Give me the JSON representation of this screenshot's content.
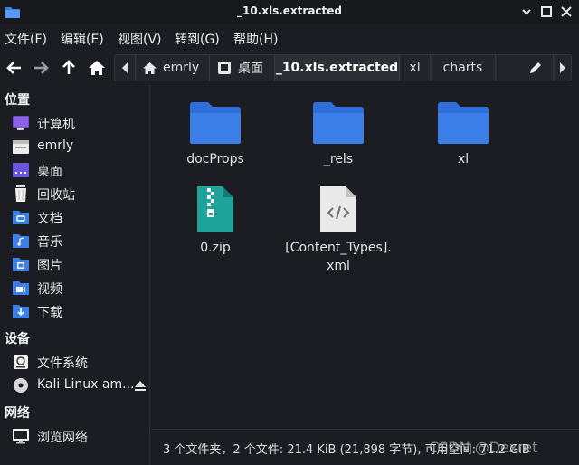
{
  "window": {
    "title": "_10.xls.extracted",
    "app_icon": "folder-icon",
    "controls": [
      "minimize-icon",
      "maximize-icon",
      "close-icon"
    ]
  },
  "menu": [
    "文件(F)",
    "编辑(E)",
    "视图(V)",
    "转到(G)",
    "帮助(H)"
  ],
  "toolbar": {
    "buttons": [
      "back-arrow-icon",
      "forward-arrow-icon",
      "up-arrow-icon",
      "home-icon"
    ],
    "path": [
      "emrly",
      "桌面",
      "_10.xls.extracted",
      "xl",
      "charts"
    ],
    "active_crumb": "_10.xls.extracted"
  },
  "sidebar": {
    "places_heading": "位置",
    "places": [
      {
        "label": "计算机",
        "icon": "computer-icon"
      },
      {
        "label": "emrly",
        "icon": "home-folder-icon"
      },
      {
        "label": "桌面",
        "icon": "desktop-icon"
      },
      {
        "label": "回收站",
        "icon": "trash-icon"
      },
      {
        "label": "文档",
        "icon": "documents-folder-icon"
      },
      {
        "label": "音乐",
        "icon": "music-folder-icon"
      },
      {
        "label": "图片",
        "icon": "pictures-folder-icon"
      },
      {
        "label": "视频",
        "icon": "videos-folder-icon"
      },
      {
        "label": "下载",
        "icon": "downloads-folder-icon"
      }
    ],
    "devices_heading": "设备",
    "devices": [
      {
        "label": "文件系统",
        "icon": "drive-icon"
      },
      {
        "label": "Kali Linux am...",
        "icon": "optical-disc-icon"
      }
    ],
    "network_heading": "网络",
    "network": [
      {
        "label": "浏览网络",
        "icon": "network-icon"
      }
    ]
  },
  "files": [
    {
      "name": "docProps",
      "type": "folder"
    },
    {
      "name": "_rels",
      "type": "folder"
    },
    {
      "name": "xl",
      "type": "folder"
    },
    {
      "name": "0.zip",
      "type": "zip"
    },
    {
      "name": "[Content_Types].xml",
      "type": "xml"
    }
  ],
  "status": "3 个文件夹，2 个文件: 21.4 KiB (21,898 字节), 可用空间: 71.2 GiB",
  "watermark": "CSDN @Dexret",
  "colors": {
    "accent": "#3b82f6",
    "folder": "#3c7ee8",
    "zip": "#1fa39a"
  }
}
